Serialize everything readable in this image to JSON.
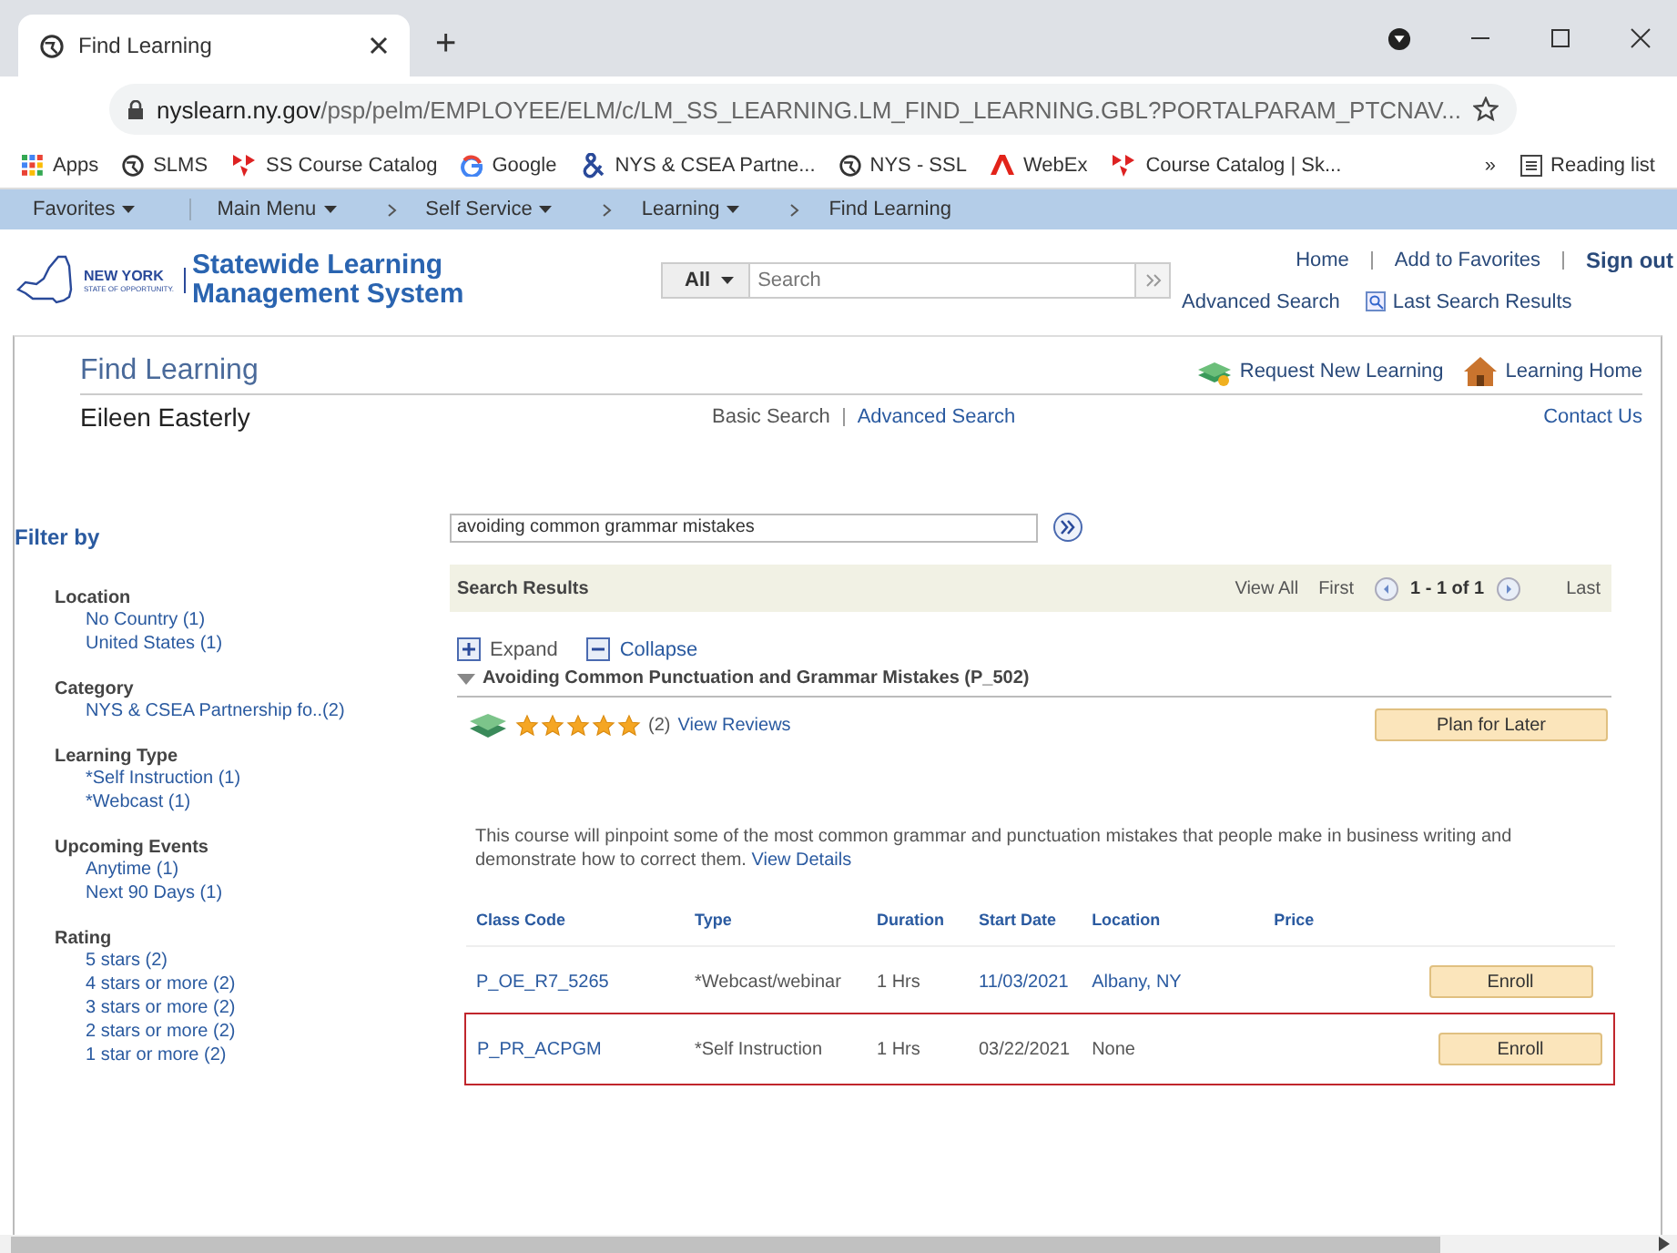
{
  "browser": {
    "tab_title": "Find Learning",
    "new_tab": "+",
    "url_host": "nyslearn.ny.gov",
    "url_path": "/psp/pelm/EMPLOYEE/ELM/c/LM_SS_LEARNING.LM_FIND_LEARNING.GBL?PORTALPARAM_PTCNAV...",
    "bookmarks": [
      {
        "label": "Apps",
        "kind": "apps"
      },
      {
        "label": "SLMS",
        "kind": "globe"
      },
      {
        "label": "SS Course Catalog",
        "kind": "flag"
      },
      {
        "label": "Google",
        "kind": "google"
      },
      {
        "label": "NYS & CSEA Partne...",
        "kind": "amp"
      },
      {
        "label": "NYS - SSL",
        "kind": "globe"
      },
      {
        "label": "WebEx",
        "kind": "adobe"
      },
      {
        "label": "Course Catalog | Sk...",
        "kind": "flag"
      }
    ],
    "more": "»",
    "reading_list": "Reading list"
  },
  "nav": [
    {
      "label": "Favorites",
      "dropdown": true
    },
    {
      "label": "Main Menu",
      "dropdown": true
    },
    {
      "label": "Self Service",
      "dropdown": true
    },
    {
      "label": "Learning",
      "dropdown": true
    },
    {
      "label": "Find Learning",
      "dropdown": false
    }
  ],
  "header": {
    "logo_top": "NEW YORK",
    "logo_sub": "STATE OF OPPORTUNITY.",
    "system_name": "Statewide Learning Management System",
    "search_scope": "All",
    "search_placeholder": "Search",
    "links": [
      "Home",
      "Add to Favorites"
    ],
    "sign_out": "Sign out",
    "advanced_search": "Advanced Search",
    "last_results": "Last Search Results"
  },
  "page": {
    "title": "Find Learning",
    "user": "Eileen Easterly",
    "request_new": "Request New Learning",
    "learning_home": "Learning Home",
    "basic_search": "Basic Search",
    "advanced_search": "Advanced Search",
    "contact_us": "Contact Us"
  },
  "filter": {
    "title": "Filter by",
    "groups": [
      {
        "heading": "Location",
        "items": [
          "No Country (1)",
          "United States (1)"
        ]
      },
      {
        "heading": "Category",
        "items": [
          "NYS & CSEA Partnership fo..(2)"
        ]
      },
      {
        "heading": "Learning Type",
        "items": [
          "*Self Instruction (1)",
          "*Webcast (1)"
        ]
      },
      {
        "heading": "Upcoming Events",
        "items": [
          "Anytime (1)",
          "Next 90 Days (1)"
        ]
      },
      {
        "heading": "Rating",
        "items": [
          "5 stars (2)",
          "4 stars or more (2)",
          "3 stars or more (2)",
          "2 stars or more (2)",
          "1 star or more (2)"
        ]
      }
    ]
  },
  "search": {
    "value": "avoiding common grammar mistakes"
  },
  "results": {
    "title": "Search Results",
    "view_all": "View All",
    "first": "First",
    "range": "1 - 1 of 1",
    "last": "Last",
    "expand": "Expand",
    "collapse": "Collapse",
    "course": {
      "title": "Avoiding Common Punctuation and Grammar Mistakes (P_502)",
      "expanded": true,
      "stars": 5,
      "review_count": "(2)",
      "view_reviews": "View Reviews",
      "plan": "Plan for Later",
      "description": "This course will pinpoint some of the most common grammar and punctuation mistakes that people make in business writing and demonstrate how to correct them.",
      "view_details": "View Details"
    },
    "columns": [
      "Class Code",
      "Type",
      "Duration",
      "Start Date",
      "Location",
      "Price"
    ],
    "rows": [
      {
        "code": "P_OE_R7_5265",
        "type": "*Webcast/webinar",
        "duration": "1 Hrs",
        "start_date": "11/03/2021",
        "location": "Albany, NY",
        "linked": true,
        "highlighted": false,
        "action": "Enroll"
      },
      {
        "code": "P_PR_ACPGM",
        "type": "*Self Instruction",
        "duration": "1 Hrs",
        "start_date": "03/22/2021",
        "location": "None",
        "linked": false,
        "highlighted": true,
        "action": "Enroll"
      }
    ]
  }
}
